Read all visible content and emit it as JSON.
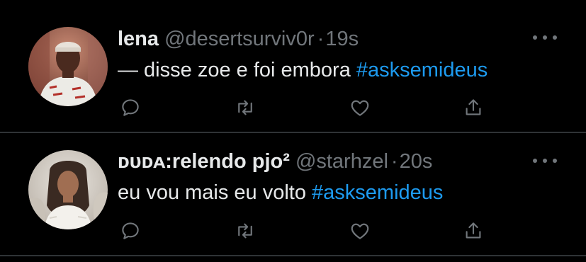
{
  "colors": {
    "background": "#000000",
    "text": "#e7e9ea",
    "muted": "#71767b",
    "hashtag": "#1d9bf0",
    "divider": "#2f3336"
  },
  "icons": [
    "reply-icon",
    "retweet-icon",
    "like-icon",
    "share-icon",
    "more-icon"
  ],
  "tweets": [
    {
      "display_name": "lena",
      "handle": "@desertsurviv0r",
      "separator": "·",
      "time": "19s",
      "text_prefix": "— disse zoe e foi embora ",
      "hashtag": "#asksemideus"
    },
    {
      "display_name": "ᴅᴜᴅᴀ:relendo pjo²",
      "handle": "@starhzel",
      "separator": "·",
      "time": "20s",
      "text_prefix": "eu vou mais eu volto ",
      "hashtag": "#asksemideus"
    }
  ]
}
